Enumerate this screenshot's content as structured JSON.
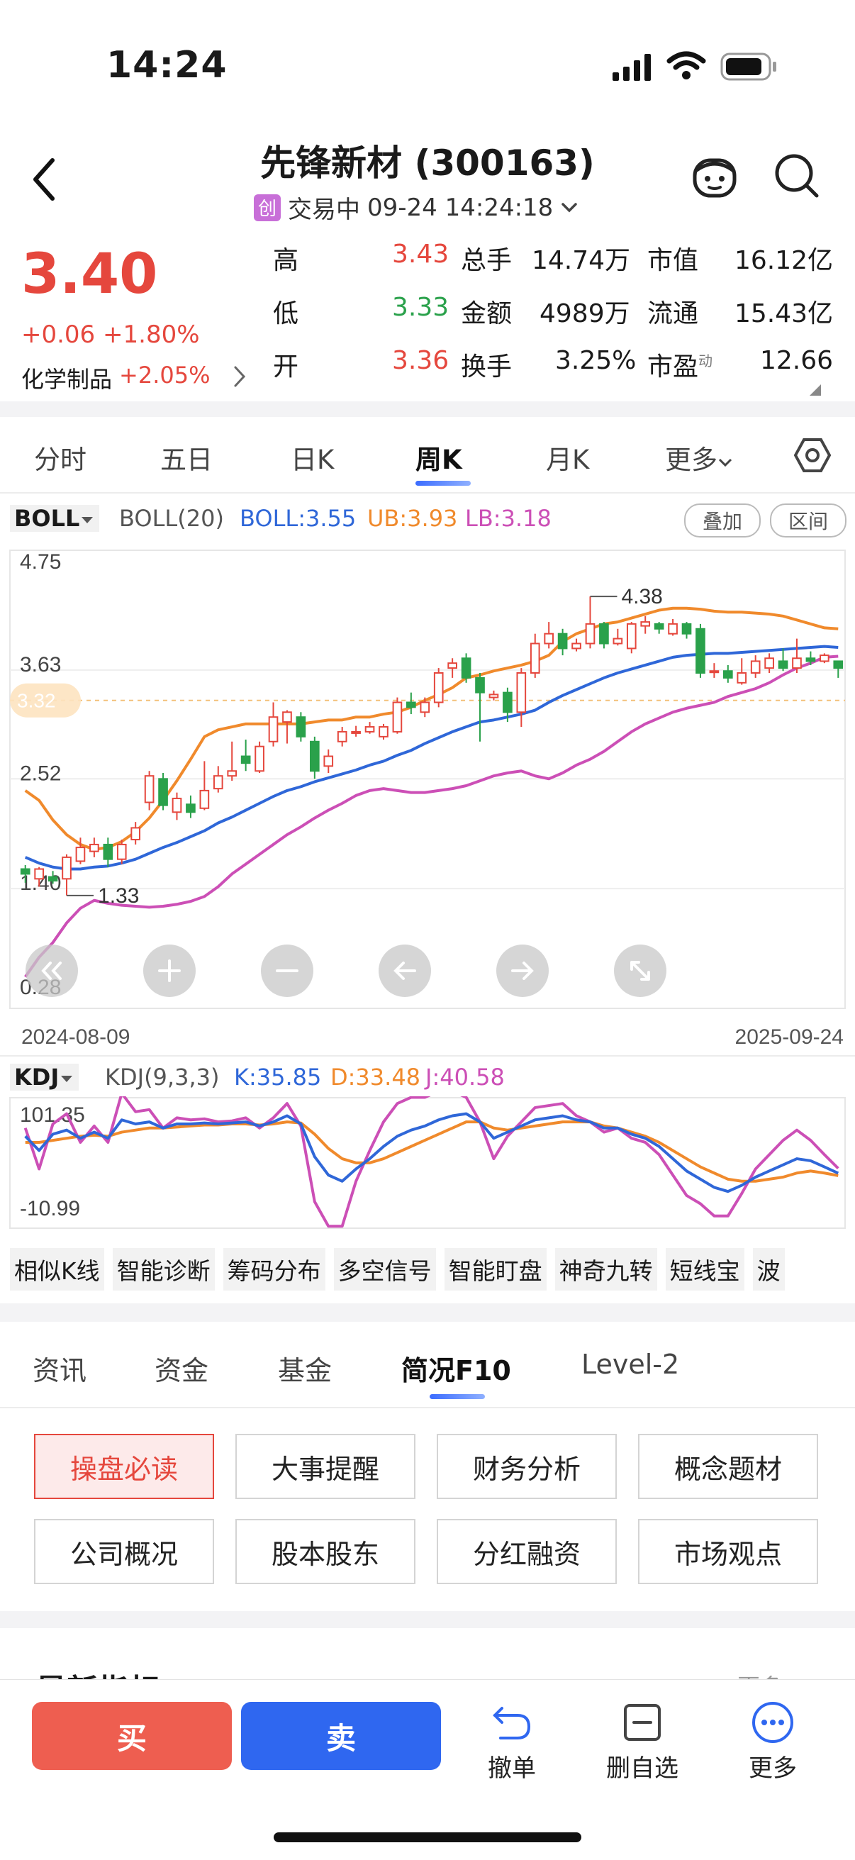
{
  "status": {
    "time": "14:24"
  },
  "header": {
    "title": "先锋新材 (300163)",
    "board_tag": "创",
    "state": "交易中",
    "datetime": "09-24 14:24:18"
  },
  "quote": {
    "price": "3.40",
    "change": "+0.06",
    "change_pct": "+1.80%",
    "industry": "化学制品",
    "industry_pct": "+2.05%",
    "rows": [
      {
        "l1": "高",
        "v1": "3.43",
        "l2": "总手",
        "v2": "14.74万",
        "l3": "市值",
        "v3": "16.12亿"
      },
      {
        "l1": "低",
        "v1": "3.33",
        "l2": "金额",
        "v2": "4989万",
        "l3": "流通",
        "v3": "15.43亿"
      },
      {
        "l1": "开",
        "v1": "3.36",
        "l2": "换手",
        "v2": "3.25%",
        "l3": "市盈",
        "v3": "12.66",
        "l3sup": "动"
      }
    ]
  },
  "period_tabs": [
    "分时",
    "五日",
    "日K",
    "周K",
    "月K",
    "更多"
  ],
  "active_period": "周K",
  "boll": {
    "name": "BOLL",
    "params": "BOLL(20)",
    "mid": "BOLL:3.55",
    "ub": "UB:3.93",
    "lb": "LB:3.18",
    "btn_overlay": "叠加",
    "btn_range": "区间"
  },
  "kdj": {
    "name": "KDJ",
    "params": "KDJ(9,3,3)",
    "k": "K:35.85",
    "d": "D:33.48",
    "j": "J:40.58",
    "ymax": "101.35",
    "ymin": "-10.99"
  },
  "chart_data": {
    "type": "candlestick",
    "y_ticks": [
      "4.75",
      "3.63",
      "2.52",
      "1.40",
      "0.28"
    ],
    "current_price_label": "3.32",
    "x_start": "2024-08-09",
    "x_end": "2025-09-24",
    "max_label": "4.38",
    "min_label": "1.33",
    "colors": {
      "up": "#e5473d",
      "down": "#2aa14b",
      "boll": "#2f67d8",
      "ub": "#f08a2c",
      "lb": "#cc4fb6",
      "k": "#2f67d8",
      "d": "#f08a2c",
      "j": "#cc4fb6"
    },
    "candles": [
      [
        1.6,
        1.55,
        1.64,
        1.46
      ],
      [
        1.5,
        1.6,
        1.62,
        1.42
      ],
      [
        1.52,
        1.48,
        1.58,
        1.45
      ],
      [
        1.5,
        1.72,
        1.75,
        1.33
      ],
      [
        1.68,
        1.82,
        1.92,
        1.65
      ],
      [
        1.78,
        1.85,
        1.92,
        1.72
      ],
      [
        1.85,
        1.7,
        1.92,
        1.62
      ],
      [
        1.7,
        1.85,
        1.9,
        1.65
      ],
      [
        1.9,
        2.02,
        2.08,
        1.85
      ],
      [
        2.28,
        2.55,
        2.6,
        2.2
      ],
      [
        2.52,
        2.25,
        2.58,
        2.2
      ],
      [
        2.18,
        2.32,
        2.38,
        2.1
      ],
      [
        2.26,
        2.18,
        2.35,
        2.12
      ],
      [
        2.22,
        2.4,
        2.7,
        2.2
      ],
      [
        2.42,
        2.55,
        2.65,
        2.38
      ],
      [
        2.55,
        2.6,
        2.9,
        2.5
      ],
      [
        2.75,
        2.68,
        2.92,
        2.6
      ],
      [
        2.6,
        2.85,
        2.9,
        2.58
      ],
      [
        2.9,
        3.15,
        3.3,
        2.85
      ],
      [
        3.1,
        3.2,
        3.22,
        2.88
      ],
      [
        3.15,
        2.95,
        3.2,
        2.9
      ],
      [
        2.9,
        2.6,
        2.95,
        2.52
      ],
      [
        2.65,
        2.75,
        2.82,
        2.58
      ],
      [
        2.9,
        3.0,
        3.05,
        2.85
      ],
      [
        3.0,
        3.0,
        3.06,
        2.95
      ],
      [
        3.0,
        3.05,
        3.1,
        2.98
      ],
      [
        2.95,
        3.05,
        3.08,
        2.92
      ],
      [
        3.0,
        3.3,
        3.35,
        2.98
      ],
      [
        3.3,
        3.25,
        3.4,
        3.18
      ],
      [
        3.2,
        3.3,
        3.35,
        3.15
      ],
      [
        3.3,
        3.6,
        3.65,
        3.25
      ],
      [
        3.65,
        3.7,
        3.75,
        3.55
      ],
      [
        3.75,
        3.55,
        3.8,
        3.5
      ],
      [
        3.55,
        3.4,
        3.6,
        2.9
      ],
      [
        3.35,
        3.38,
        3.42,
        3.32
      ],
      [
        3.4,
        3.2,
        3.45,
        3.1
      ],
      [
        3.2,
        3.6,
        3.65,
        3.05
      ],
      [
        3.6,
        3.9,
        4.0,
        3.55
      ],
      [
        3.9,
        4.0,
        4.12,
        3.85
      ],
      [
        4.0,
        3.85,
        4.05,
        3.78
      ],
      [
        3.85,
        3.9,
        3.95,
        3.82
      ],
      [
        3.9,
        4.1,
        4.38,
        3.85
      ],
      [
        4.1,
        3.9,
        4.12,
        3.85
      ],
      [
        3.9,
        3.95,
        4.05,
        3.88
      ],
      [
        3.85,
        4.1,
        4.12,
        3.8
      ],
      [
        4.08,
        4.12,
        4.18,
        4.0
      ],
      [
        4.1,
        4.05,
        4.12,
        4.0
      ],
      [
        4.0,
        4.1,
        4.15,
        3.98
      ],
      [
        4.1,
        4.0,
        4.12,
        3.95
      ],
      [
        4.05,
        3.6,
        4.1,
        3.55
      ],
      [
        3.62,
        3.62,
        3.7,
        3.55
      ],
      [
        3.62,
        3.55,
        3.68,
        3.5
      ],
      [
        3.5,
        3.6,
        3.75,
        3.48
      ],
      [
        3.6,
        3.72,
        3.78,
        3.55
      ],
      [
        3.65,
        3.75,
        3.8,
        3.6
      ],
      [
        3.72,
        3.65,
        3.85,
        3.62
      ],
      [
        3.65,
        3.75,
        3.95,
        3.6
      ],
      [
        3.75,
        3.72,
        3.82,
        3.68
      ],
      [
        3.72,
        3.78,
        3.8,
        3.7
      ],
      [
        3.72,
        3.65,
        3.72,
        3.55
      ]
    ],
    "boll_mid": [
      1.72,
      1.66,
      1.62,
      1.6,
      1.6,
      1.62,
      1.63,
      1.66,
      1.7,
      1.76,
      1.82,
      1.87,
      1.93,
      1.99,
      2.07,
      2.13,
      2.2,
      2.27,
      2.34,
      2.4,
      2.44,
      2.49,
      2.53,
      2.57,
      2.61,
      2.66,
      2.7,
      2.76,
      2.81,
      2.88,
      2.94,
      3.0,
      3.05,
      3.1,
      3.12,
      3.15,
      3.18,
      3.22,
      3.3,
      3.37,
      3.43,
      3.49,
      3.55,
      3.6,
      3.64,
      3.68,
      3.72,
      3.76,
      3.78,
      3.79,
      3.8,
      3.8,
      3.81,
      3.82,
      3.83,
      3.84,
      3.85,
      3.86,
      3.87,
      3.86
    ],
    "boll_ub": [
      2.4,
      2.3,
      2.1,
      1.95,
      1.85,
      1.8,
      1.82,
      1.88,
      1.98,
      2.12,
      2.3,
      2.5,
      2.72,
      2.95,
      3.02,
      3.05,
      3.08,
      3.08,
      3.08,
      3.08,
      3.08,
      3.1,
      3.12,
      3.12,
      3.15,
      3.15,
      3.18,
      3.2,
      3.25,
      3.32,
      3.38,
      3.45,
      3.55,
      3.58,
      3.62,
      3.65,
      3.68,
      3.72,
      3.78,
      3.92,
      4.0,
      4.05,
      4.1,
      4.12,
      4.16,
      4.2,
      4.24,
      4.26,
      4.26,
      4.25,
      4.23,
      4.22,
      4.22,
      4.21,
      4.2,
      4.18,
      4.14,
      4.1,
      4.06,
      4.05
    ],
    "boll_lb": [
      0.5,
      0.7,
      0.85,
      1.05,
      1.2,
      1.28,
      1.25,
      1.23,
      1.22,
      1.21,
      1.22,
      1.24,
      1.27,
      1.32,
      1.42,
      1.55,
      1.65,
      1.75,
      1.85,
      1.95,
      2.03,
      2.12,
      2.2,
      2.27,
      2.35,
      2.4,
      2.42,
      2.4,
      2.38,
      2.38,
      2.4,
      2.42,
      2.45,
      2.5,
      2.55,
      2.58,
      2.6,
      2.55,
      2.52,
      2.58,
      2.66,
      2.72,
      2.8,
      2.9,
      3.0,
      3.08,
      3.14,
      3.2,
      3.24,
      3.27,
      3.3,
      3.36,
      3.4,
      3.44,
      3.5,
      3.58,
      3.65,
      3.7,
      3.76,
      3.77
    ],
    "kdj_k": [
      72,
      58,
      74,
      78,
      70,
      76,
      70,
      88,
      84,
      86,
      80,
      84,
      84,
      85,
      84,
      85,
      86,
      82,
      86,
      92,
      84,
      52,
      34,
      28,
      40,
      50,
      62,
      72,
      78,
      82,
      88,
      92,
      94,
      86,
      70,
      76,
      82,
      88,
      90,
      92,
      88,
      86,
      80,
      80,
      74,
      70,
      62,
      50,
      38,
      30,
      22,
      18,
      24,
      32,
      38,
      44,
      50,
      48,
      42,
      35.85
    ],
    "kdj_d": [
      66,
      66,
      68,
      70,
      72,
      73,
      72,
      76,
      78,
      80,
      80,
      81,
      82,
      83,
      83,
      84,
      84,
      83,
      84,
      86,
      85,
      74,
      60,
      50,
      46,
      46,
      50,
      56,
      62,
      68,
      74,
      80,
      86,
      86,
      80,
      78,
      80,
      82,
      84,
      86,
      86,
      86,
      82,
      80,
      76,
      72,
      66,
      58,
      50,
      42,
      36,
      30,
      28,
      28,
      30,
      32,
      36,
      38,
      36,
      33.48
    ],
    "kdj_j": [
      80,
      40,
      84,
      94,
      66,
      82,
      66,
      114,
      96,
      98,
      80,
      90,
      88,
      89,
      86,
      87,
      90,
      80,
      90,
      104,
      82,
      8,
      -16,
      -16,
      28,
      58,
      86,
      104,
      110,
      110,
      116,
      116,
      110,
      86,
      50,
      72,
      86,
      100,
      102,
      104,
      92,
      86,
      76,
      80,
      70,
      66,
      54,
      34,
      14,
      6,
      -6,
      -6,
      16,
      40,
      54,
      68,
      78,
      68,
      54,
      40.58
    ]
  },
  "tools": [
    "相似K线",
    "智能诊断",
    "筹码分布",
    "多空信号",
    "智能盯盘",
    "神奇九转",
    "短线宝",
    "波"
  ],
  "info_tabs": [
    "资讯",
    "资金",
    "基金",
    "简况F10",
    "Level-2"
  ],
  "active_info_tab": "简况F10",
  "f10_buttons": [
    "操盘必读",
    "大事提醒",
    "财务分析",
    "概念题材",
    "公司概况",
    "股本股东",
    "分红融资",
    "市场观点"
  ],
  "section_peek": {
    "title": "最新指标",
    "more": "更多"
  },
  "bottom_bar": {
    "buy": "买",
    "sell": "卖",
    "cancel": "撤单",
    "remove": "删自选",
    "more": "更多"
  }
}
